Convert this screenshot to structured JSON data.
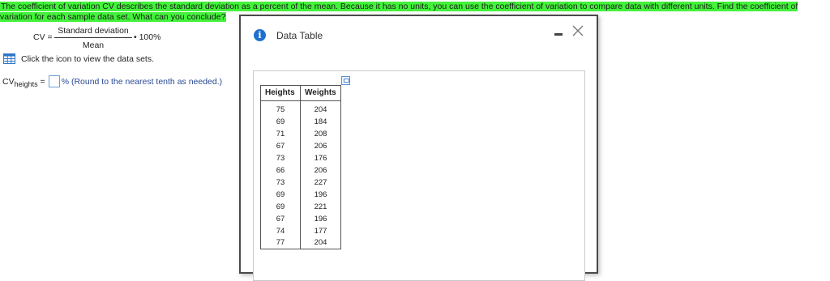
{
  "problem": {
    "intro_text": "The coefficient of variation CV describes the standard deviation as a percent of the mean. Because it has no units, you can use the coefficient of variation to compare data with different units. Find the coefficient of variation for each sample data set. What can you conclude?",
    "highlight_color": "#43f23a",
    "formula": {
      "lhs": "CV =",
      "numerator": "Standard deviation",
      "denominator": "Mean",
      "rhs": "• 100%"
    },
    "click_text": "Click the icon to view the data sets.",
    "table_icon": "table-grid-icon",
    "answer": {
      "label_main": "CV",
      "label_sub": "heights",
      "equals": "=",
      "value": "",
      "unit_hint": "% (Round to the nearest tenth as needed.)"
    }
  },
  "dialog": {
    "icon": "info-icon",
    "info_glyph": "i",
    "title": "Data Table",
    "minimize_icon": "minimize-icon",
    "close_icon": "close-icon",
    "copy_icon": "copy-icon",
    "table": {
      "headers": [
        "Heights",
        "Weights"
      ],
      "rows": [
        [
          "75",
          "204"
        ],
        [
          "69",
          "184"
        ],
        [
          "71",
          "208"
        ],
        [
          "67",
          "206"
        ],
        [
          "73",
          "176"
        ],
        [
          "66",
          "206"
        ],
        [
          "73",
          "227"
        ],
        [
          "69",
          "196"
        ],
        [
          "69",
          "221"
        ],
        [
          "67",
          "196"
        ],
        [
          "74",
          "177"
        ],
        [
          "77",
          "204"
        ]
      ]
    }
  },
  "colors": {
    "accent_blue": "#1f6fd0",
    "hint_text": "#2b4a96",
    "input_border": "#6fa0d8"
  }
}
